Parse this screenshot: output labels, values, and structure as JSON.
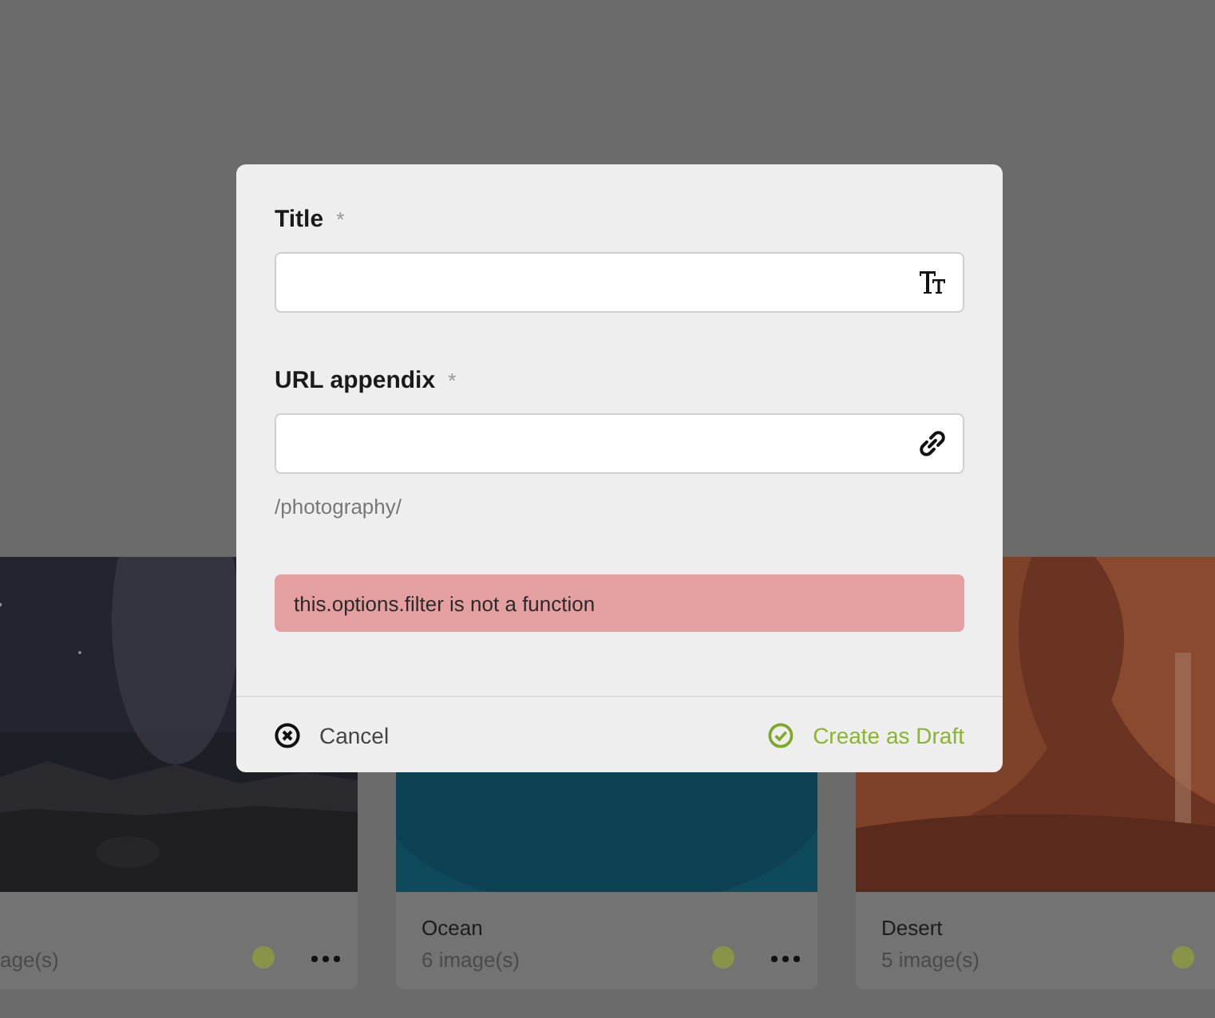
{
  "albums": [
    {
      "count": "age(s)"
    },
    {
      "name": "Ocean",
      "count": "6 image(s)"
    },
    {
      "name": "Desert",
      "count": "5 image(s)"
    }
  ],
  "dialog": {
    "fields": [
      {
        "label": "Title",
        "required_mark": "*"
      },
      {
        "label": "URL appendix",
        "required_mark": "*",
        "hint": "/photography/"
      }
    ],
    "error": "this.options.filter is not a function",
    "cancel": "Cancel",
    "submit": "Create as Draft"
  }
}
